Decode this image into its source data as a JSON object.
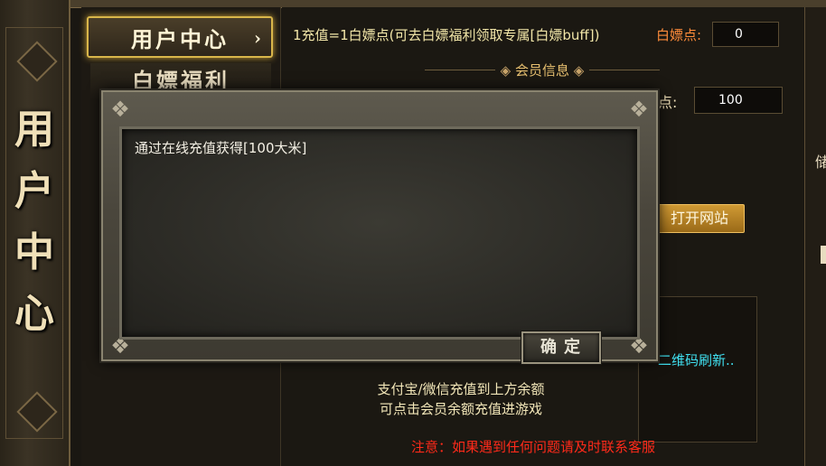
{
  "sidebar": {
    "vertical_title": [
      "用",
      "户",
      "中",
      "心"
    ]
  },
  "nav": {
    "active_label": "用户中心",
    "active_arrow": "›",
    "second_label": "白嫖福利"
  },
  "header": {
    "info_text": "1充值=1白嫖点(可去白嫖福利领取专属[白嫖buff])",
    "points_label": "白嫖点:",
    "points_value": "0"
  },
  "member": {
    "section_title": "会员信息",
    "partial_label": "点:",
    "partial_value": "100",
    "open_site_label": "打开网站",
    "qr_refresh_text": "二维码刷新.."
  },
  "notes": {
    "pay_line1": "支付宝/微信充值到上方余额",
    "pay_line2": "可点击会员余额充值进游戏",
    "warning": "注意：如果遇到任何问题请及时联系客服"
  },
  "dialog": {
    "message": "通过在线充值获得[100大米]",
    "confirm_label": "确定"
  },
  "colors": {
    "accent_gold": "#d9b64a",
    "warning_red": "#ff2a1a",
    "qr_cyan": "#40e0f0",
    "points_orange": "#ff8c3a"
  }
}
